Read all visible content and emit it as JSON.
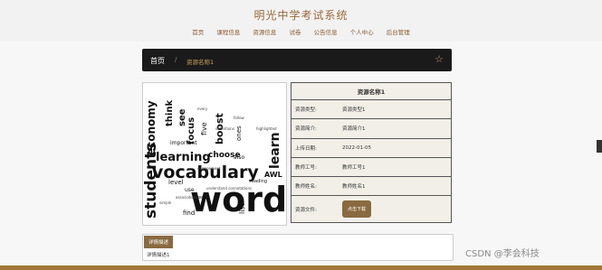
{
  "header": {
    "site_title": "明光中学考试系统",
    "nav": [
      "首页",
      "课程信息",
      "资源信息",
      "试卷",
      "公告信息",
      "个人中心",
      "后台管理"
    ]
  },
  "breadcrumb": {
    "home": "首页",
    "separator": "/",
    "current": "资源名称1"
  },
  "resource": {
    "title": "资源名称1",
    "rows": [
      {
        "label": "资源类型:",
        "value": "资源类型1"
      },
      {
        "label": "资源简介:",
        "value": "资源简介1"
      },
      {
        "label": "上传日期:",
        "value": "2022-01-05"
      },
      {
        "label": "教师工号:",
        "value": "教师工号1"
      },
      {
        "label": "教师姓名:",
        "value": "教师姓名1"
      }
    ],
    "file_label": "资源文件:",
    "download_label": "点击下载"
  },
  "detail": {
    "tab_label": "详情描述",
    "text": "详情描述1"
  },
  "wordcloud": {
    "words": [
      "word",
      "vocabulary",
      "students",
      "learning",
      "economy",
      "boost",
      "learn",
      "focus",
      "choose",
      "five",
      "important",
      "think",
      "see",
      "level",
      "find",
      "also",
      "ones",
      "list",
      "reading",
      "use",
      "way",
      "AWL"
    ]
  },
  "watermark": "CSDN @李会科技",
  "colors": {
    "accent": "#8a6a40",
    "nav_text": "#8a5a30",
    "breadcrumb_bg": "#1a1a1a",
    "footer": "#a07838"
  }
}
